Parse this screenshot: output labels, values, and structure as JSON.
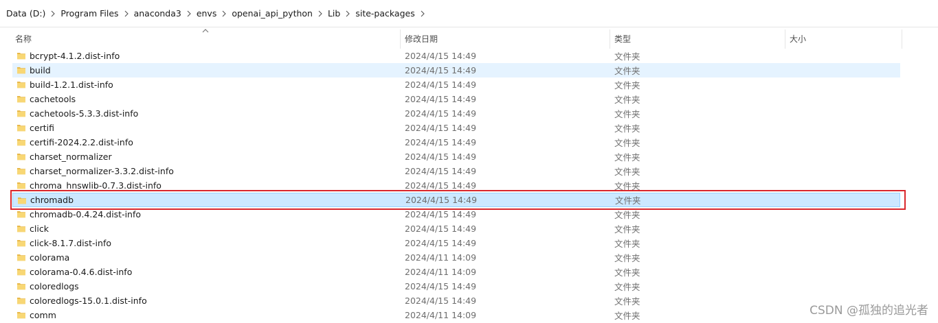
{
  "breadcrumb": [
    "Data (D:)",
    "Program Files",
    "anaconda3",
    "envs",
    "openai_api_python",
    "Lib",
    "site-packages"
  ],
  "columns": {
    "name": "名称",
    "date": "修改日期",
    "type": "类型",
    "size": "大小"
  },
  "rows": [
    {
      "name": "bcrypt-4.1.2.dist-info",
      "date": "2024/4/15 14:49",
      "type": "文件夹"
    },
    {
      "name": "build",
      "date": "2024/4/15 14:49",
      "type": "文件夹"
    },
    {
      "name": "build-1.2.1.dist-info",
      "date": "2024/4/15 14:49",
      "type": "文件夹"
    },
    {
      "name": "cachetools",
      "date": "2024/4/15 14:49",
      "type": "文件夹"
    },
    {
      "name": "cachetools-5.3.3.dist-info",
      "date": "2024/4/15 14:49",
      "type": "文件夹"
    },
    {
      "name": "certifi",
      "date": "2024/4/15 14:49",
      "type": "文件夹"
    },
    {
      "name": "certifi-2024.2.2.dist-info",
      "date": "2024/4/15 14:49",
      "type": "文件夹"
    },
    {
      "name": "charset_normalizer",
      "date": "2024/4/15 14:49",
      "type": "文件夹"
    },
    {
      "name": "charset_normalizer-3.3.2.dist-info",
      "date": "2024/4/15 14:49",
      "type": "文件夹"
    },
    {
      "name": "chroma_hnswlib-0.7.3.dist-info",
      "date": "2024/4/15 14:49",
      "type": "文件夹"
    },
    {
      "name": "chromadb",
      "date": "2024/4/15 14:49",
      "type": "文件夹"
    },
    {
      "name": "chromadb-0.4.24.dist-info",
      "date": "2024/4/15 14:49",
      "type": "文件夹"
    },
    {
      "name": "click",
      "date": "2024/4/15 14:49",
      "type": "文件夹"
    },
    {
      "name": "click-8.1.7.dist-info",
      "date": "2024/4/15 14:49",
      "type": "文件夹"
    },
    {
      "name": "colorama",
      "date": "2024/4/11 14:09",
      "type": "文件夹"
    },
    {
      "name": "colorama-0.4.6.dist-info",
      "date": "2024/4/11 14:09",
      "type": "文件夹"
    },
    {
      "name": "coloredlogs",
      "date": "2024/4/15 14:49",
      "type": "文件夹"
    },
    {
      "name": "coloredlogs-15.0.1.dist-info",
      "date": "2024/4/15 14:49",
      "type": "文件夹"
    },
    {
      "name": "comm",
      "date": "2024/4/11 14:09",
      "type": "文件夹"
    }
  ],
  "hover_row": "build",
  "selected_row": "chromadb",
  "watermark": "CSDN @孤独的追光者",
  "colors": {
    "folder": "#f8d775",
    "hover": "#e5f3ff",
    "selected": "#cce8ff",
    "annotation": "#d9262b"
  }
}
